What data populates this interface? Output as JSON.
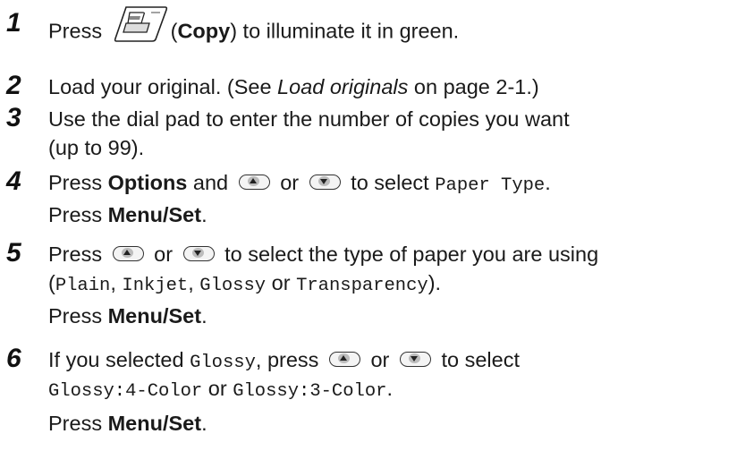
{
  "steps": [
    {
      "num": "1",
      "l1": {
        "a": "Press ",
        "b": "(",
        "c": "Copy",
        "d": ") to illuminate it in green."
      }
    },
    {
      "num": "2",
      "l1": {
        "a": "Load your original. (See ",
        "b": "Load originals",
        "c": " on page 2-1.)"
      }
    },
    {
      "num": "3",
      "l1": "Use the dial pad to enter the number of copies you want",
      "l2": "(up to 99)."
    },
    {
      "num": "4",
      "l1": {
        "a": "Press ",
        "b": "Options",
        "c": " and ",
        "d": " or ",
        "e": " to select ",
        "f": "Paper Type",
        "g": "."
      },
      "l2": {
        "a": "Press ",
        "b": "Menu/Set",
        "c": "."
      }
    },
    {
      "num": "5",
      "l1": {
        "a": "Press ",
        "b": " or ",
        "c": " to select the type of paper you are using"
      },
      "l2": {
        "a": "(",
        "b": "Plain",
        "c": ", ",
        "d": "Inkjet",
        "e": ", ",
        "f": "Glossy",
        "g": " or ",
        "h": "Transparency",
        "i": ")."
      },
      "l3": {
        "a": "Press ",
        "b": "Menu/Set",
        "c": "."
      }
    },
    {
      "num": "6",
      "l1": {
        "a": "If you selected ",
        "b": "Glossy",
        "c": ", press ",
        "d": " or ",
        "e": " to select"
      },
      "l2": {
        "a": "Glossy:4-Color",
        "b": " or ",
        "c": "Glossy:3-Color",
        "d": "."
      },
      "l3": {
        "a": "Press ",
        "b": "Menu/Set",
        "c": "."
      }
    }
  ],
  "icons": {
    "copy": "copy-key-icon",
    "up": "up-arrow-key-icon",
    "down": "down-arrow-key-icon"
  }
}
